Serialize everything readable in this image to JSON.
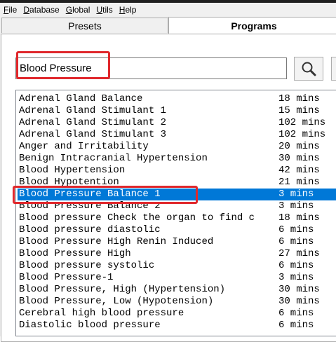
{
  "menu": [
    {
      "first": "F",
      "rest": "ile"
    },
    {
      "first": "D",
      "rest": "atabase"
    },
    {
      "first": "G",
      "rest": "lobal"
    },
    {
      "first": "U",
      "rest": "tils"
    },
    {
      "first": "H",
      "rest": "elp"
    }
  ],
  "tabs": {
    "presets": "Presets",
    "programs": "Programs"
  },
  "search": {
    "value": "Blood Pressure",
    "icon": "search-icon"
  },
  "programs": [
    {
      "name": "Adrenal Gland Balance",
      "duration": "18 mins"
    },
    {
      "name": "Adrenal Gland Stimulant 1",
      "duration": "15 mins"
    },
    {
      "name": "Adrenal Gland Stimulant 2",
      "duration": "102 mins"
    },
    {
      "name": "Adrenal Gland Stimulant 3",
      "duration": "102 mins"
    },
    {
      "name": "Anger and Irritability",
      "duration": "20 mins"
    },
    {
      "name": "Benign Intracranial Hypertension",
      "duration": "30 mins"
    },
    {
      "name": "Blood Hypertension",
      "duration": "42 mins"
    },
    {
      "name": "Blood Hypotention",
      "duration": "21 mins"
    },
    {
      "name": "Blood Pressure Balance 1",
      "duration": "3 mins",
      "selected": true
    },
    {
      "name": "Blood Pressure Balance 2",
      "duration": "3 mins"
    },
    {
      "name": "Blood pressure Check the organ to find c",
      "duration": "18 mins"
    },
    {
      "name": "Blood pressure diastolic",
      "duration": "6 mins"
    },
    {
      "name": "Blood Pressure High Renin Induced",
      "duration": "6 mins"
    },
    {
      "name": "Blood Pressure High",
      "duration": "27 mins"
    },
    {
      "name": "Blood pressure systolic",
      "duration": "6 mins"
    },
    {
      "name": "Blood Pressure-1",
      "duration": "3 mins"
    },
    {
      "name": "Blood Pressure, High (Hypertension)",
      "duration": "30 mins"
    },
    {
      "name": "Blood Pressure, Low (Hypotension)",
      "duration": "30 mins"
    },
    {
      "name": "Cerebral high blood pressure",
      "duration": "6 mins"
    },
    {
      "name": "Diastolic blood pressure",
      "duration": "6 mins"
    },
    {
      "name": "",
      "duration": ""
    }
  ],
  "colors": {
    "selection": "#0078d7",
    "annotation": "#e0282c"
  }
}
